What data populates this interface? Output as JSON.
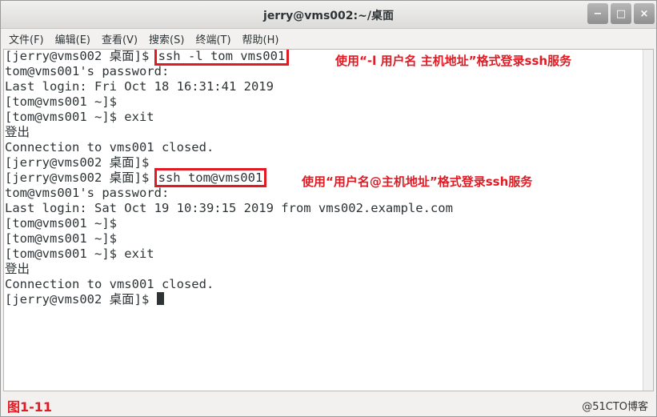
{
  "window": {
    "title": "jerry@vms002:~/桌面",
    "minimize_symbol": "−",
    "maximize_symbol": "□",
    "close_symbol": "×"
  },
  "menu": [
    "文件(F)",
    "编辑(E)",
    "查看(V)",
    "搜索(S)",
    "终端(T)",
    "帮助(H)"
  ],
  "terminal": {
    "lines": [
      {
        "prompt": "[jerry@vms002 桌面]$ ",
        "cmd": "ssh -l tom vms001",
        "boxed": true
      },
      {
        "text": "tom@vms001's password:"
      },
      {
        "text": "Last login: Fri Oct 18 16:31:41 2019"
      },
      {
        "text": "[tom@vms001 ~]$"
      },
      {
        "text": "[tom@vms001 ~]$ exit"
      },
      {
        "text": "登出"
      },
      {
        "text": "Connection to vms001 closed."
      },
      {
        "text": "[jerry@vms002 桌面]$"
      },
      {
        "prompt": "[jerry@vms002 桌面]$ ",
        "cmd": "ssh tom@vms001",
        "boxed": true
      },
      {
        "text": "tom@vms001's password:"
      },
      {
        "text": "Last login: Sat Oct 19 10:39:15 2019 from vms002.example.com"
      },
      {
        "text": "[tom@vms001 ~]$"
      },
      {
        "text": "[tom@vms001 ~]$"
      },
      {
        "text": "[tom@vms001 ~]$ exit"
      },
      {
        "text": "登出"
      },
      {
        "text": "Connection to vms001 closed."
      },
      {
        "prompt": "[jerry@vms002 桌面]$ ",
        "cursor": true
      }
    ]
  },
  "annotations": {
    "first": "使用“-l 用户名 主机地址”格式登录ssh服务",
    "second": "使用“用户名@主机地址”格式登录ssh服务"
  },
  "figure_label": "图1-11",
  "watermark": "@51CTO博客",
  "colors": {
    "annotation_red": "#e01b24",
    "terminal_text": "#2e3436",
    "terminal_bg": "#ffffff"
  }
}
